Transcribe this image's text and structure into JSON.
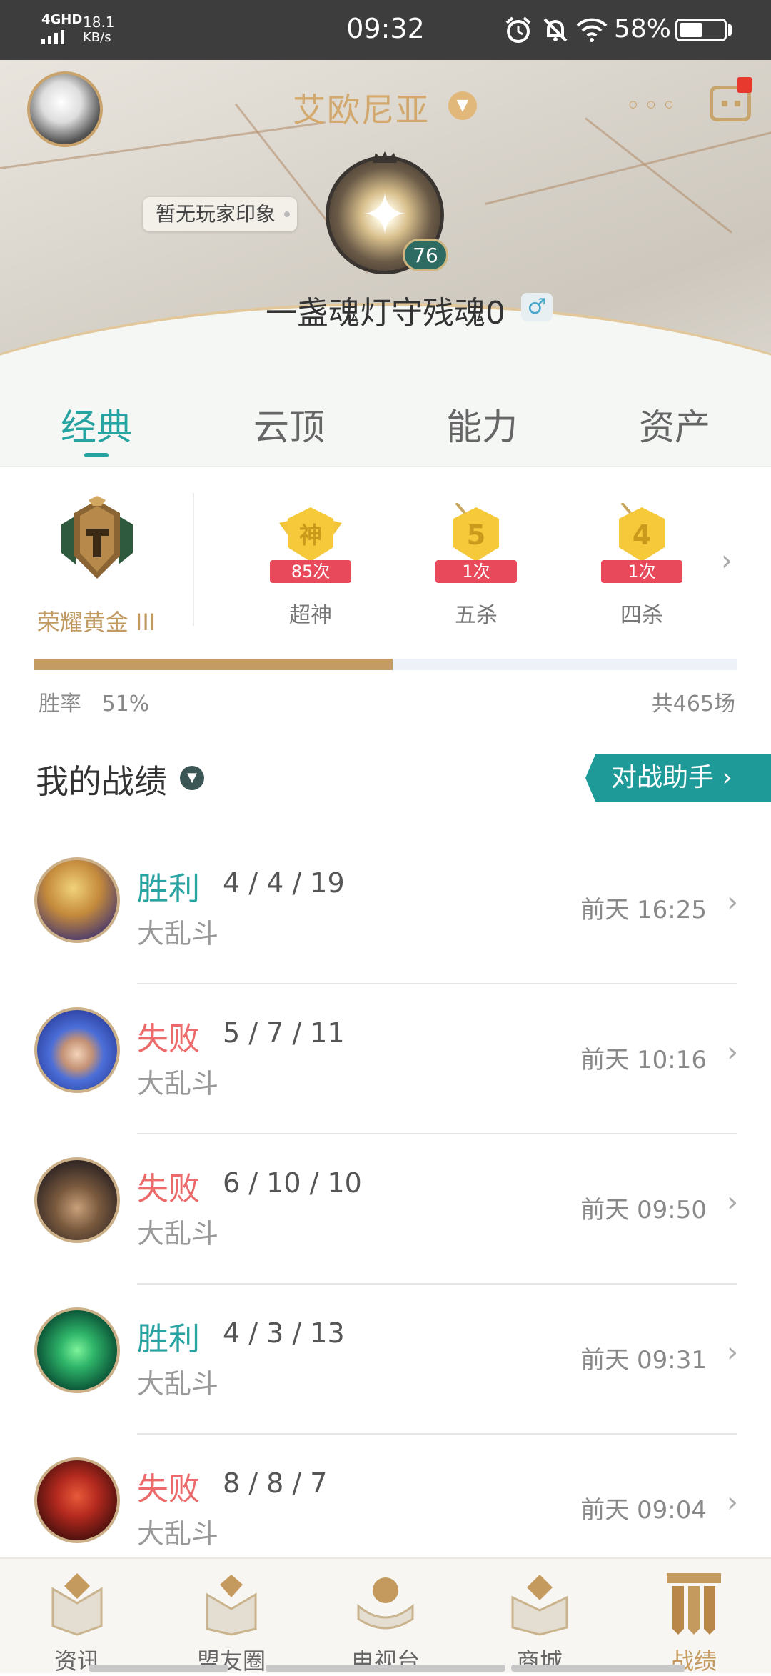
{
  "status_bar": {
    "network": "4GHD",
    "speed": "18.1",
    "speed_unit": "KB/s",
    "time": "09:32",
    "battery_percent": "58%",
    "battery_level": 0.58,
    "icons": [
      "signal-icon",
      "alarm-icon",
      "bell-muted-icon",
      "wifi-icon",
      "battery-icon"
    ]
  },
  "header": {
    "server": "艾欧尼亚",
    "impression": "暂无玩家印象",
    "level": "76",
    "player_name": "一盏魂灯守残魂0",
    "gender_symbol": "♂"
  },
  "tabs": [
    "经典",
    "云顶",
    "能力",
    "资产"
  ],
  "active_tab": 0,
  "rank": {
    "name": "荣耀黄金 III"
  },
  "achievements": [
    {
      "badge": "神",
      "count": "85次",
      "label": "超神"
    },
    {
      "badge": "5",
      "count": "1次",
      "label": "五杀"
    },
    {
      "badge": "4",
      "count": "1次",
      "label": "四杀"
    }
  ],
  "stats": {
    "winrate_label": "胜率",
    "winrate_value": "51%",
    "winrate_fraction": 0.51,
    "total_games": "共465场"
  },
  "section": {
    "title": "我的战绩",
    "helper_button": "对战助手"
  },
  "matches": [
    {
      "result": "胜利",
      "outcome": "win",
      "kda": "4 / 4 / 19",
      "mode": "大乱斗",
      "time": "前天 16:25"
    },
    {
      "result": "失败",
      "outcome": "lose",
      "kda": "5 / 7 / 11",
      "mode": "大乱斗",
      "time": "前天 10:16"
    },
    {
      "result": "失败",
      "outcome": "lose",
      "kda": "6 / 10 / 10",
      "mode": "大乱斗",
      "time": "前天 09:50"
    },
    {
      "result": "胜利",
      "outcome": "win",
      "kda": "4 / 3 / 13",
      "mode": "大乱斗",
      "time": "前天 09:31"
    },
    {
      "result": "失败",
      "outcome": "lose",
      "kda": "8 / 8 / 7",
      "mode": "大乱斗",
      "time": "前天 09:04"
    }
  ],
  "bottom_nav": [
    {
      "label": "资讯",
      "icon": "news-icon"
    },
    {
      "label": "盟友圈",
      "icon": "friends-circle-icon"
    },
    {
      "label": "电视台",
      "icon": "tv-icon"
    },
    {
      "label": "商城",
      "icon": "shop-icon"
    },
    {
      "label": "战绩",
      "icon": "records-icon"
    }
  ],
  "active_nav": 4,
  "colors": {
    "accent_teal": "#27a3a2",
    "win": "#27a3a2",
    "lose": "#ec6a6a",
    "gold": "#c49a5e",
    "badge_red": "#e8495b"
  }
}
